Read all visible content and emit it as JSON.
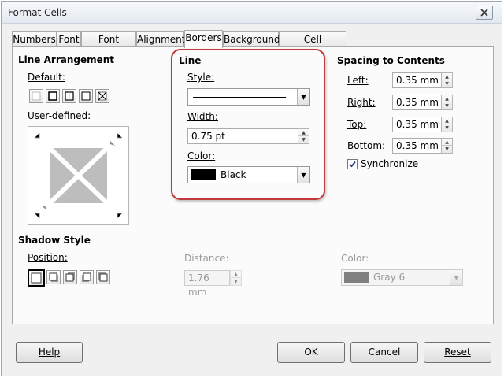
{
  "window": {
    "title": "Format Cells"
  },
  "tabs": [
    "Numbers",
    "Font",
    "Font Effects",
    "Alignment",
    "Borders",
    "Background",
    "Cell Protection"
  ],
  "line_arrangement": {
    "heading": "Line Arrangement",
    "default_label": "Default:",
    "user_defined_label": "User-defined:"
  },
  "line": {
    "heading": "Line",
    "style_label": "Style:",
    "width_label": "Width:",
    "width_value": "0.75 pt",
    "color_label": "Color:",
    "color_value": "Black",
    "color_swatch": "#000000"
  },
  "spacing": {
    "heading": "Spacing to Contents",
    "left_label": "Left:",
    "left_value": "0.35 mm",
    "right_label": "Right:",
    "right_value": "0.35 mm",
    "top_label": "Top:",
    "top_value": "0.35 mm",
    "bottom_label": "Bottom:",
    "bottom_value": "0.35 mm",
    "sync_label": "Synchronize",
    "sync_checked": true
  },
  "shadow": {
    "heading": "Shadow Style",
    "position_label": "Position:",
    "distance_label": "Distance:",
    "distance_value": "1.76 mm",
    "color_label": "Color:",
    "color_value": "Gray 6",
    "color_swatch": "#808080"
  },
  "buttons": {
    "help": "Help",
    "ok": "OK",
    "cancel": "Cancel",
    "reset": "Reset"
  },
  "colors": {
    "highlight": "#c0393b",
    "preview_gray": "#b4b4b4"
  }
}
